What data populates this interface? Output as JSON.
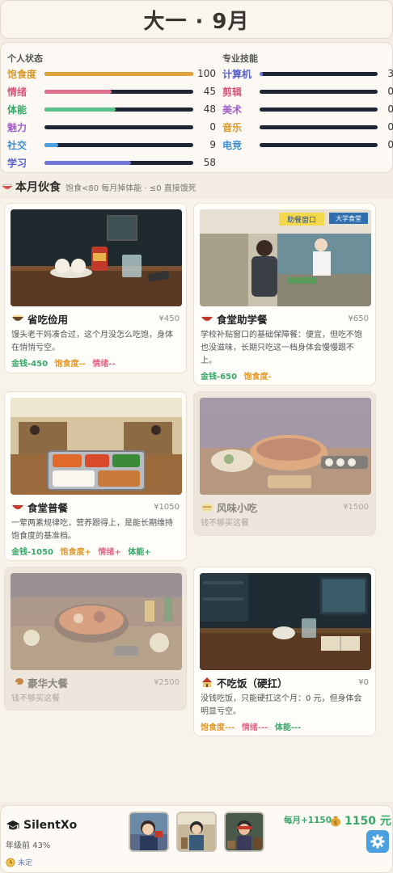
{
  "header": {
    "title": "大一 · 9月"
  },
  "status": {
    "title": "个人状态",
    "stats": [
      {
        "label": "饱食度",
        "value": "100",
        "fill": 1.0,
        "color": "#e0a23c",
        "label_color": "#d99a2b"
      },
      {
        "label": "情绪",
        "value": "45",
        "fill": 0.45,
        "color": "#e0708e",
        "label_color": "#d8587a"
      },
      {
        "label": "体能",
        "value": "48",
        "fill": 0.48,
        "color": "#5cbf8c",
        "label_color": "#3aa66a"
      },
      {
        "label": "魅力",
        "value": "0",
        "fill": 0.0,
        "color": "#a97bd6",
        "label_color": "#a061c9"
      },
      {
        "label": "社交",
        "value": "9",
        "fill": 0.09,
        "color": "#4aa0e0",
        "label_color": "#3f8fd0"
      },
      {
        "label": "学习",
        "value": "58",
        "fill": 0.58,
        "color": "#6f78d9",
        "label_color": "#5963c9"
      }
    ]
  },
  "skills": {
    "title": "专业技能",
    "items": [
      {
        "label": "计算机",
        "value": "3",
        "fill": 0.03,
        "color": "#6f78d9",
        "label_color": "#5963c9"
      },
      {
        "label": "剪辑",
        "value": "0",
        "fill": 0.0,
        "color": "#e0708e",
        "label_color": "#d8587a"
      },
      {
        "label": "美术",
        "value": "0",
        "fill": 0.0,
        "color": "#a97bd6",
        "label_color": "#a061c9"
      },
      {
        "label": "音乐",
        "value": "0",
        "fill": 0.0,
        "color": "#e0a23c",
        "label_color": "#d99a2b"
      },
      {
        "label": "电竞",
        "value": "0",
        "fill": 0.0,
        "color": "#4aa0e0",
        "label_color": "#3f8fd0"
      }
    ]
  },
  "meals_section": {
    "title": "本月伙食",
    "subtitle": "饱食<80 每月掉体能 · ≤0 直接饿死"
  },
  "meals": [
    {
      "name": "省吃俭用",
      "price": "¥450",
      "desc": "馒头老干妈凑合过，这个月没怎么吃饱，身体在悄悄亏空。",
      "effects": [
        {
          "text": "金钱-450",
          "color": "#3aa66a"
        },
        {
          "text": "饱食度--",
          "color": "#e09a2b"
        },
        {
          "text": "情绪--",
          "color": "#e06a86"
        }
      ],
      "disabled": false,
      "icon": "bowl-icon"
    },
    {
      "name": "食堂助学餐",
      "price": "¥650",
      "desc": "学校补贴窗口的基础保障餐：便宜，但吃不饱也没滋味，长期只吃这一档身体会慢慢跟不上。",
      "effects": [
        {
          "text": "金钱-650",
          "color": "#3aa66a"
        },
        {
          "text": "饱食度-",
          "color": "#e09a2b"
        }
      ],
      "disabled": false,
      "icon": "rice-bowl-icon",
      "sign_left": "助餐窗口",
      "sign_right": "大学食堂"
    },
    {
      "name": "食堂普餐",
      "price": "¥1050",
      "desc": "一荤两素规律吃，营养跟得上，是能长期维持饱食度的基准档。",
      "effects": [
        {
          "text": "金钱-1050",
          "color": "#3aa66a"
        },
        {
          "text": "饱食度+",
          "color": "#e09a2b"
        },
        {
          "text": "情绪+",
          "color": "#e06a86"
        },
        {
          "text": "体能+",
          "color": "#3aa66a"
        }
      ],
      "disabled": false,
      "icon": "rice-bowl-icon"
    },
    {
      "name": "风味小吃",
      "price": "¥1500",
      "desc": "钱不够买这餐",
      "effects": [],
      "disabled": true,
      "icon": "snack-icon"
    },
    {
      "name": "豪华大餐",
      "price": "¥2500",
      "desc": "钱不够买这餐",
      "effects": [],
      "disabled": true,
      "icon": "drumstick-icon"
    },
    {
      "name": "不吃饭（硬扛）",
      "price": "¥0",
      "desc": "没钱吃饭，只能硬扛这个月：0 元，但身体会明显亏空。",
      "effects": [
        {
          "text": "饱食度---",
          "color": "#e09a2b"
        },
        {
          "text": "情绪---",
          "color": "#e06a86"
        },
        {
          "text": "体能---",
          "color": "#3aa66a"
        }
      ],
      "disabled": false,
      "icon": "house-icon"
    }
  ],
  "footer": {
    "player_name": "SilentXo",
    "progress": "年级前 43%",
    "unknown": "未定",
    "monthly": "每月+1150",
    "money": "1150 元"
  },
  "colors": {
    "accent": "#4aa0e0",
    "money": "#3aa66a",
    "bar_track": "#1f2533"
  }
}
